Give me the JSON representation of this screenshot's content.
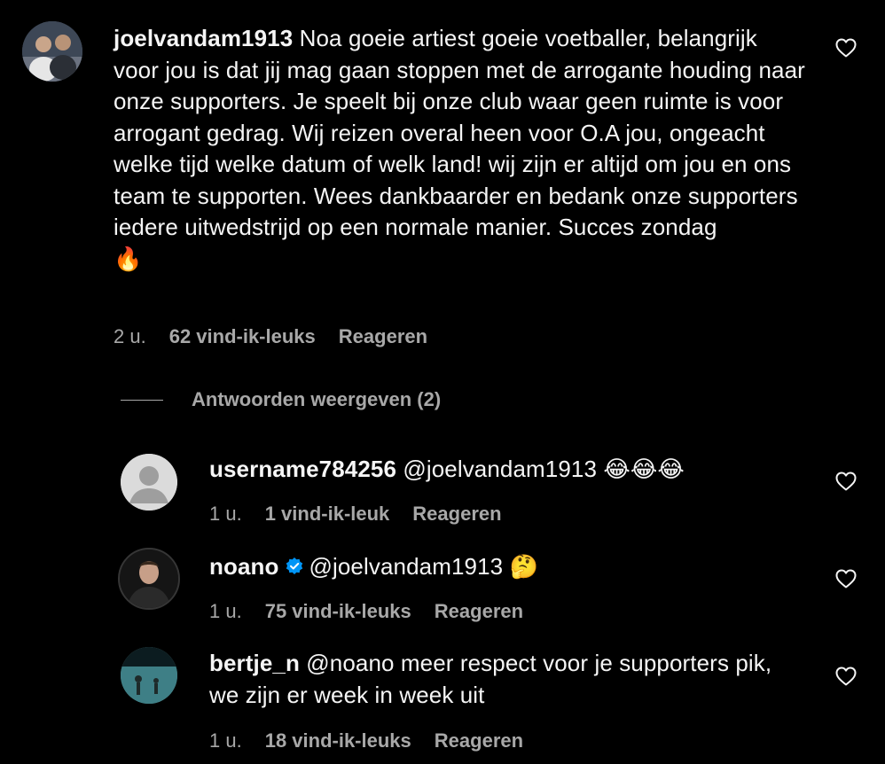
{
  "comments": [
    {
      "username": "joelvandam1913",
      "text": "Noa goeie artiest goeie voetballer, belangrijk voor jou is dat jij mag gaan stoppen met de arrogante houding naar onze supporters. Je speelt bij onze club waar geen ruimte is voor arrogant gedrag. Wij reizen overal heen voor O.A jou, ongeacht welke tijd welke datum of welk land! wij zijn er altijd om jou en ons team te supporten. Wees dankbaarder en bedank onze supporters iedere uitwedstrijd op een normale manier. Succes zondag",
      "emoji": "🔥",
      "time": "2 u.",
      "likes": "62 vind-ik-leuks",
      "reply_label": "Reageren"
    }
  ],
  "replies_toggle": "Antwoorden weergeven (2)",
  "replies": [
    {
      "username": "username784256",
      "text": "@joelvandam1913",
      "emoji": "😂😂😂",
      "time": "1 u.",
      "likes": "1 vind-ik-leuk",
      "reply_label": "Reageren"
    },
    {
      "username": "noano",
      "verified": true,
      "text": "@joelvandam1913",
      "emoji": "🤔",
      "time": "1 u.",
      "likes": "75 vind-ik-leuks",
      "reply_label": "Reageren"
    },
    {
      "username": "bertje_n",
      "text": "@noano meer respect voor je supporters pik, we zijn er week in week uit",
      "time": "1 u.",
      "likes": "18 vind-ik-leuks",
      "reply_label": "Reageren"
    }
  ],
  "colors": {
    "background": "#000000",
    "text": "#f5f5f5",
    "secondary": "#a8a8a8",
    "verified": "#0095f6"
  },
  "icons": [
    "heart-icon",
    "verified-badge-icon",
    "default-avatar-icon"
  ]
}
